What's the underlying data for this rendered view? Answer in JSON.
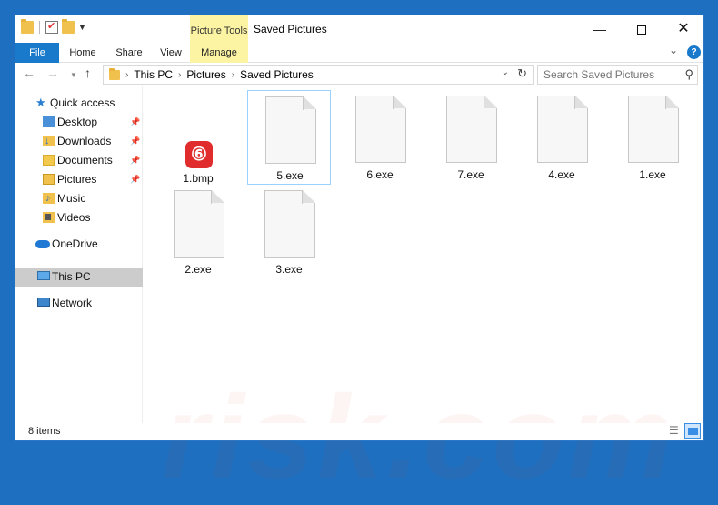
{
  "window": {
    "title": "Saved Pictures",
    "context_tab_group": "Picture Tools",
    "controls": {
      "minimize": "—",
      "close": "✕"
    }
  },
  "ribbon": {
    "tabs": [
      "File",
      "Home",
      "Share",
      "View",
      "Manage"
    ],
    "help": "?"
  },
  "address": {
    "crumbs": [
      "This PC",
      "Pictures",
      "Saved Pictures"
    ]
  },
  "search": {
    "placeholder": "Search Saved Pictures"
  },
  "nav": {
    "quick_access": "Quick access",
    "pinned": [
      {
        "label": "Desktop",
        "icon": "desktop-folder-icon"
      },
      {
        "label": "Downloads",
        "icon": "downloads-folder-icon"
      },
      {
        "label": "Documents",
        "icon": "documents-folder-icon"
      },
      {
        "label": "Pictures",
        "icon": "pictures-folder-icon"
      }
    ],
    "others": [
      {
        "label": "Music",
        "icon": "music-folder-icon"
      },
      {
        "label": "Videos",
        "icon": "videos-folder-icon"
      }
    ],
    "onedrive": "OneDrive",
    "this_pc": "This PC",
    "network": "Network"
  },
  "files": [
    {
      "name": "1.bmp",
      "type": "app-icon"
    },
    {
      "name": "5.exe",
      "type": "blank-file-icon",
      "selected": true
    },
    {
      "name": "6.exe",
      "type": "blank-file-icon"
    },
    {
      "name": "7.exe",
      "type": "blank-file-icon"
    },
    {
      "name": "4.exe",
      "type": "blank-file-icon"
    },
    {
      "name": "1.exe",
      "type": "blank-file-icon"
    },
    {
      "name": "2.exe",
      "type": "blank-file-icon"
    },
    {
      "name": "3.exe",
      "type": "blank-file-icon"
    }
  ],
  "status": {
    "item_count": "8 items"
  },
  "watermark": "risk.com",
  "colors": {
    "accent": "#1979ca",
    "picture_tools": "#fcf4a3",
    "selection_border": "#99d1ff",
    "nav_selected": "#cccccc"
  }
}
